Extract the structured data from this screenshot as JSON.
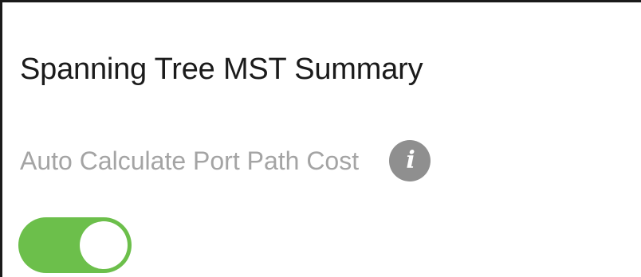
{
  "section": {
    "title": "Spanning Tree MST Summary"
  },
  "setting": {
    "label": "Auto Calculate Port Path Cost",
    "info_icon": "info-icon",
    "info_glyph": "i",
    "toggle_state": "on",
    "toggle_color": "#6cbf4b"
  }
}
